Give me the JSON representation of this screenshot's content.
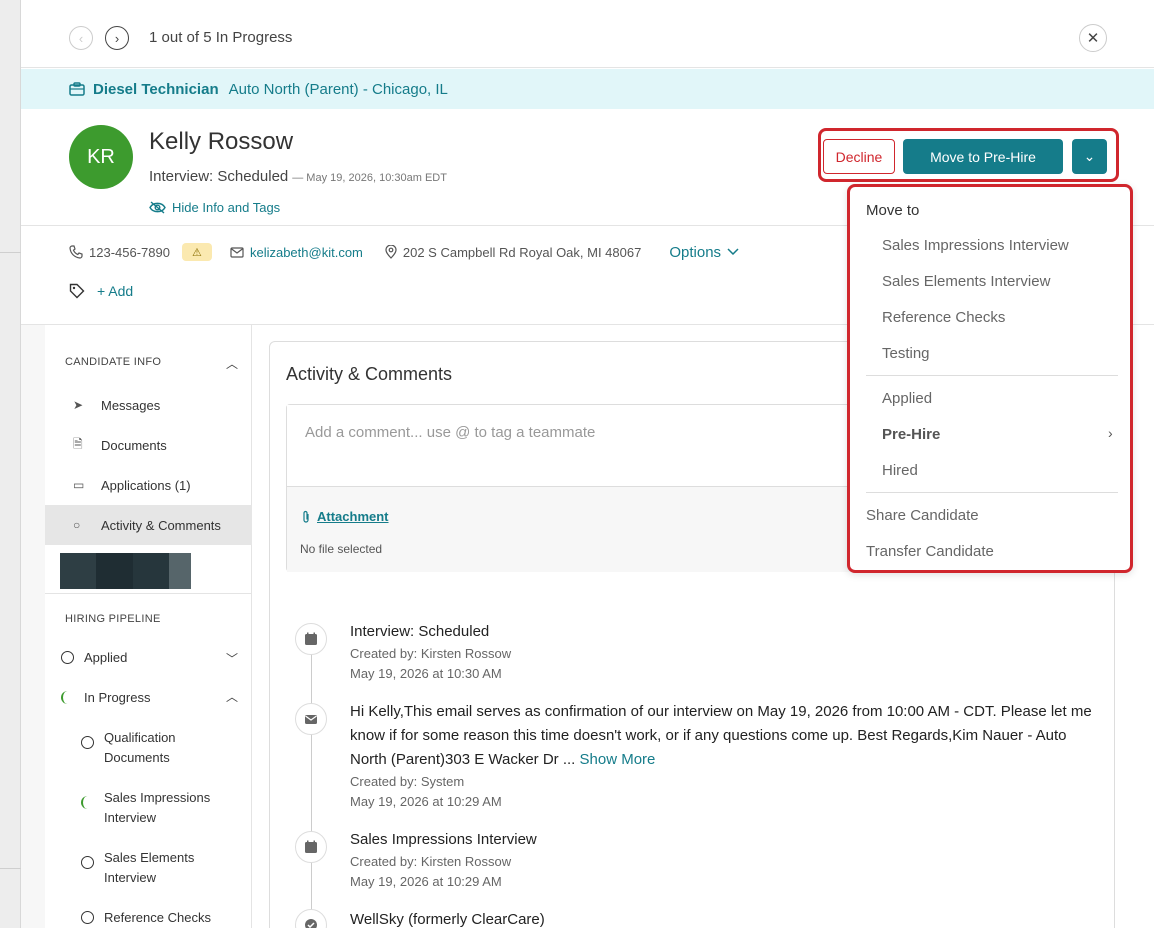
{
  "nav": {
    "prev_icon": "chevron-left-icon",
    "next_icon": "chevron-right-icon",
    "progress": "1 out of 5 In Progress",
    "close_icon": "close-icon"
  },
  "job": {
    "title": "Diesel Technician",
    "location": "Auto North (Parent) - Chicago, IL"
  },
  "candidate": {
    "initials": "KR",
    "name": "Kelly Rossow",
    "status": "Interview: Scheduled",
    "status_date": "— May 19, 2026, 10:30am EDT",
    "hide_info": "Hide Info and Tags",
    "phone": "123-456-7890",
    "warning_icon": "⚠",
    "email": "kelizabeth@kit.com",
    "address": "202 S Campbell Rd Royal Oak, MI 48067",
    "options": "Options",
    "add_tag": "+ Add"
  },
  "actions": {
    "decline": "Decline",
    "move": "Move to Pre-Hire"
  },
  "dropdown": {
    "heading": "Move to",
    "group1": [
      "Sales Impressions Interview",
      "Sales Elements Interview",
      "Reference Checks",
      "Testing"
    ],
    "group2": [
      "Applied",
      "Pre-Hire",
      "Hired"
    ],
    "group3": [
      "Share Candidate",
      "Transfer Candidate"
    ]
  },
  "sidebar": {
    "candidate_info": "CANDIDATE INFO",
    "items": [
      "Messages",
      "Documents",
      "Applications (1)",
      "Activity & Comments"
    ],
    "hiring_pipeline": "HIRING PIPELINE",
    "pipeline": [
      "Applied",
      "In Progress"
    ],
    "sub_pipeline": [
      "Qualification Documents",
      "Sales Impressions Interview",
      "Sales Elements Interview",
      "Reference Checks"
    ]
  },
  "activity": {
    "title": "Activity & Comments",
    "placeholder": "Add a comment... use @ to tag a teammate",
    "attachment": "Attachment",
    "no_file": "No file selected",
    "entries": [
      {
        "title": "Interview: Scheduled",
        "created": "Created by: Kirsten Rossow",
        "date": "May 19, 2026 at 10:30 AM"
      },
      {
        "title": "Hi Kelly,This email serves as confirmation of our interview on May 19, 2026 from 10:00 AM - CDT. Please let me know if for some reason this time doesn't work, or if any questions come up. Best Regards,Kim Nauer - Auto North (Parent)303 E Wacker Dr ...",
        "show_more": "Show More",
        "created": "Created by: System",
        "date": "May 19, 2026 at 10:29 AM"
      },
      {
        "title": "Sales Impressions Interview",
        "created": "Created by: Kirsten Rossow",
        "date": "May 19, 2026 at 10:29 AM"
      },
      {
        "title": "WellSky (formerly ClearCare)"
      }
    ]
  },
  "colors": {
    "accent": "#157c8a",
    "danger": "#d0262d",
    "avatar": "#3d9b2e"
  }
}
